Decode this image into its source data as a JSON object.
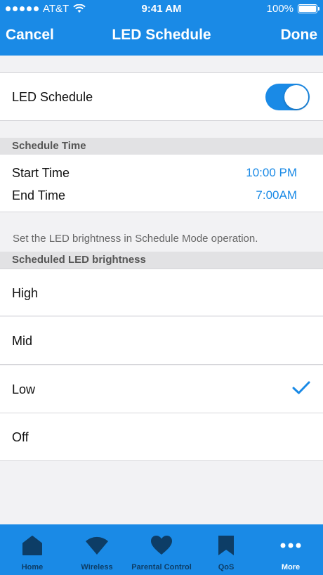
{
  "status_bar": {
    "carrier": "AT&T",
    "time": "9:41 AM",
    "battery": "100%"
  },
  "nav": {
    "cancel": "Cancel",
    "title": "LED Schedule",
    "done": "Done"
  },
  "led_schedule": {
    "label": "LED Schedule",
    "enabled": true
  },
  "schedule_time": {
    "header": "Schedule Time",
    "start_label": "Start Time",
    "start_value": "10:00 PM",
    "end_label": "End Time",
    "end_value": "7:00AM"
  },
  "info_text": "Set the LED brightness in Schedule Mode operation.",
  "brightness": {
    "header": "Scheduled LED brightness",
    "options": [
      {
        "label": "High",
        "selected": false
      },
      {
        "label": "Mid",
        "selected": false
      },
      {
        "label": "Low",
        "selected": true
      },
      {
        "label": "Off",
        "selected": false
      }
    ]
  },
  "tabs": [
    {
      "label": "Home",
      "icon": "home-icon",
      "active": false
    },
    {
      "label": "Wireless",
      "icon": "wireless-icon",
      "active": false
    },
    {
      "label": "Parental Control",
      "icon": "heart-icon",
      "active": false
    },
    {
      "label": "QoS",
      "icon": "bookmark-icon",
      "active": false
    },
    {
      "label": "More",
      "icon": "more-icon",
      "active": true
    }
  ],
  "colors": {
    "accent": "#1a8ae6",
    "tab_inactive": "#0d3d66"
  }
}
